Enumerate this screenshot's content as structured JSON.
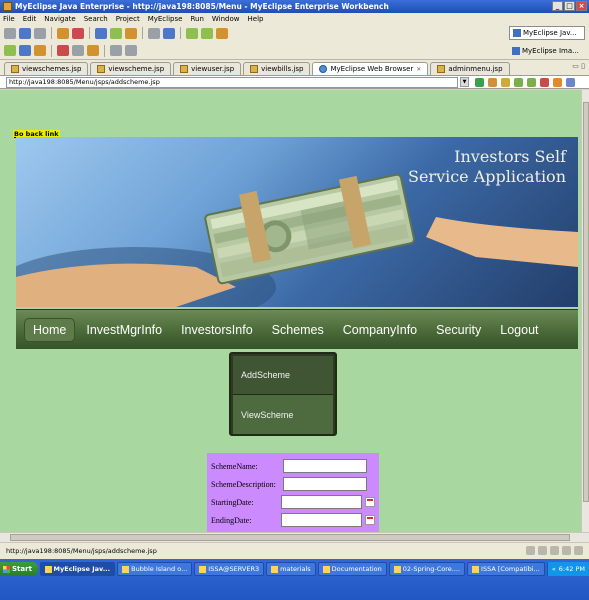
{
  "window": {
    "title": "MyEclipse Java Enterprise - http://java198:8085/Menu - MyEclipse Enterprise Workbench",
    "min_glyph": "_",
    "max_glyph": "□",
    "close_glyph": "×"
  },
  "menubar": {
    "items": [
      "File",
      "Edit",
      "Navigate",
      "Search",
      "Project",
      "MyEclipse",
      "Run",
      "Window",
      "Help"
    ]
  },
  "perspectives": {
    "primary": "MyEclipse Jav...",
    "secondary": "MyEclipse Ima..."
  },
  "editor_tabs": [
    {
      "label": "viewschemes.jsp",
      "active": false,
      "icon": "jsp-file-icon"
    },
    {
      "label": "viewscheme.jsp",
      "active": false,
      "icon": "jsp-file-icon"
    },
    {
      "label": "viewuser.jsp",
      "active": false,
      "icon": "jsp-file-icon"
    },
    {
      "label": "viewbills.jsp",
      "active": false,
      "icon": "jsp-file-icon"
    },
    {
      "label": "MyEclipse Web Browser",
      "active": true,
      "icon": "web-browser-icon"
    },
    {
      "label": "adminmenu.jsp",
      "active": false,
      "icon": "jsp-file-icon"
    }
  ],
  "browser": {
    "url": "http://java198:8085/Menu/jsps/addscheme.jsp"
  },
  "page": {
    "back_link": "Bo back link",
    "banner_line1": "Investors Self",
    "banner_line2": "Service Application",
    "nav": [
      "Home",
      "InvestMgrInfo",
      "InvestorsInfo",
      "Schemes",
      "CompanyInfo",
      "Security",
      "Logout"
    ],
    "dropdown": [
      "AddScheme",
      "ViewScheme"
    ],
    "form": {
      "scheme_name_label": "SchemeName:",
      "scheme_name_value": "",
      "scheme_description_label": "SchemeDescription:",
      "scheme_description_value": "",
      "starting_date_label": "StartingDate:",
      "starting_date_value": "",
      "ending_date_label": "EndingDate:",
      "ending_date_value": ""
    },
    "colors": {
      "page_background": "#a8d8a0",
      "nav_background": "#4a6a38",
      "form_background": "#cc8aff"
    }
  },
  "statusbar": {
    "text": "http://java198:8085/Menu/jsps/addscheme.jsp"
  },
  "taskbar": {
    "start_label": "Start",
    "tasks": [
      {
        "label": "MyEclipse Jav...",
        "active": true
      },
      {
        "label": "Bubble Island o...",
        "active": false
      },
      {
        "label": "ISSA@SERVER3",
        "active": false
      },
      {
        "label": "materials",
        "active": false
      },
      {
        "label": "Documentation",
        "active": false
      },
      {
        "label": "02-Spring-Core....",
        "active": false
      },
      {
        "label": "ISSA [Compatibi...",
        "active": false
      }
    ],
    "clock": "6:42 PM"
  }
}
